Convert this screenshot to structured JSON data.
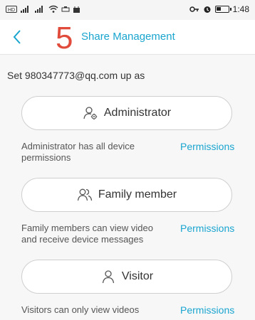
{
  "status_bar": {
    "left_icons": [
      "hd-icon",
      "signal-icon",
      "signal-icon",
      "wifi-icon",
      "usb-icon",
      "notification-icon"
    ],
    "time": "1:48"
  },
  "header": {
    "step_number": "5",
    "title": "Share Management"
  },
  "setup_label": "Set 980347773@qq.com up as",
  "roles": [
    {
      "label": "Administrator",
      "icon": "admin-icon",
      "description": "Administrator has all device permissions",
      "permissions_label": "Permissions"
    },
    {
      "label": "Family member",
      "icon": "family-icon",
      "description": "Family members can view video and receive device messages",
      "permissions_label": "Permissions"
    },
    {
      "label": "Visitor",
      "icon": "visitor-icon",
      "description": "Visitors can only view videos",
      "permissions_label": "Permissions"
    }
  ]
}
